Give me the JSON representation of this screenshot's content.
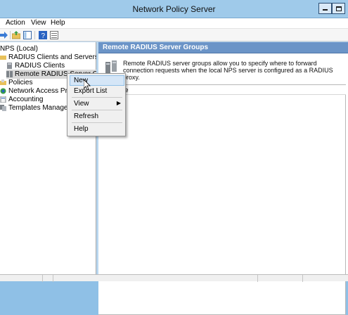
{
  "window": {
    "title": "Network Policy Server"
  },
  "menubar": {
    "items": [
      "Action",
      "View",
      "Help"
    ]
  },
  "tree": {
    "nodes": [
      {
        "label": "NPS (Local)",
        "icon": "server-icon"
      },
      {
        "label": "RADIUS Clients and Servers",
        "icon": "folder-icon"
      },
      {
        "label": "RADIUS Clients",
        "icon": "clients-icon"
      },
      {
        "label": "Remote RADIUS Server G",
        "icon": "server-group-icon"
      },
      {
        "label": "Policies",
        "icon": "folder-icon"
      },
      {
        "label": "Network Access Pro",
        "icon": "network-access-icon"
      },
      {
        "label": "Accounting",
        "icon": "accounting-icon"
      },
      {
        "label": "Templates Manage",
        "icon": "templates-icon"
      }
    ]
  },
  "content": {
    "header": "Remote RADIUS Server Groups",
    "description": "Remote RADIUS server groups allow you to specify where to forward connection requests when the local NPS server is configured as a RADIUS proxy.",
    "column_header": "me"
  },
  "context_menu": {
    "items": [
      {
        "label": "New",
        "hover": true
      },
      {
        "label": "Export List"
      },
      {
        "label": "View",
        "has_submenu": true
      },
      {
        "label": "Refresh"
      },
      {
        "label": "Help"
      }
    ]
  },
  "colors": {
    "accent": "#6b94c7",
    "titlebar": "#9fcaea"
  }
}
